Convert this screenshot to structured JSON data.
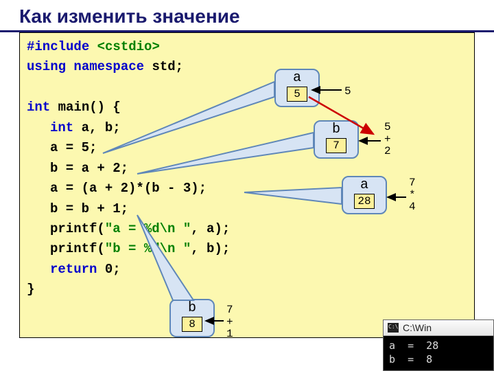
{
  "title": "Как изменить значение",
  "code": {
    "l1a": "#include ",
    "l1b": "<cstdio>",
    "l2a": "using namespace ",
    "l2b": "std;",
    "l3a": "int ",
    "l3b": "main() {",
    "l4a": "int ",
    "l4b": "a, b;",
    "l5": "a = 5;",
    "l6": "b = a + 2;",
    "l7": "a = (a + 2)*(b - 3);",
    "l8": "b = b + 1;",
    "l9a": "printf(",
    "l9b": "\"a = %d\\n \"",
    "l9c": ", a);",
    "l10a": "printf(",
    "l10b": "\"b = %d\\n \"",
    "l10c": ", b);",
    "l11": "return ",
    "l11b": "0;",
    "l12": "}"
  },
  "boxes": {
    "a1": {
      "name": "a",
      "val": "5"
    },
    "b1": {
      "name": "b",
      "val": "7"
    },
    "a2": {
      "name": "a",
      "val": "28"
    },
    "b2": {
      "name": "b",
      "val": "8"
    }
  },
  "annot": {
    "r1": "5",
    "r2": "5\n+\n2",
    "r3": "7\n*\n4",
    "r4": "7\n+\n1"
  },
  "console": {
    "title": "C:\\Win",
    "line1": "a  =  28",
    "line2": "b  =  8"
  }
}
